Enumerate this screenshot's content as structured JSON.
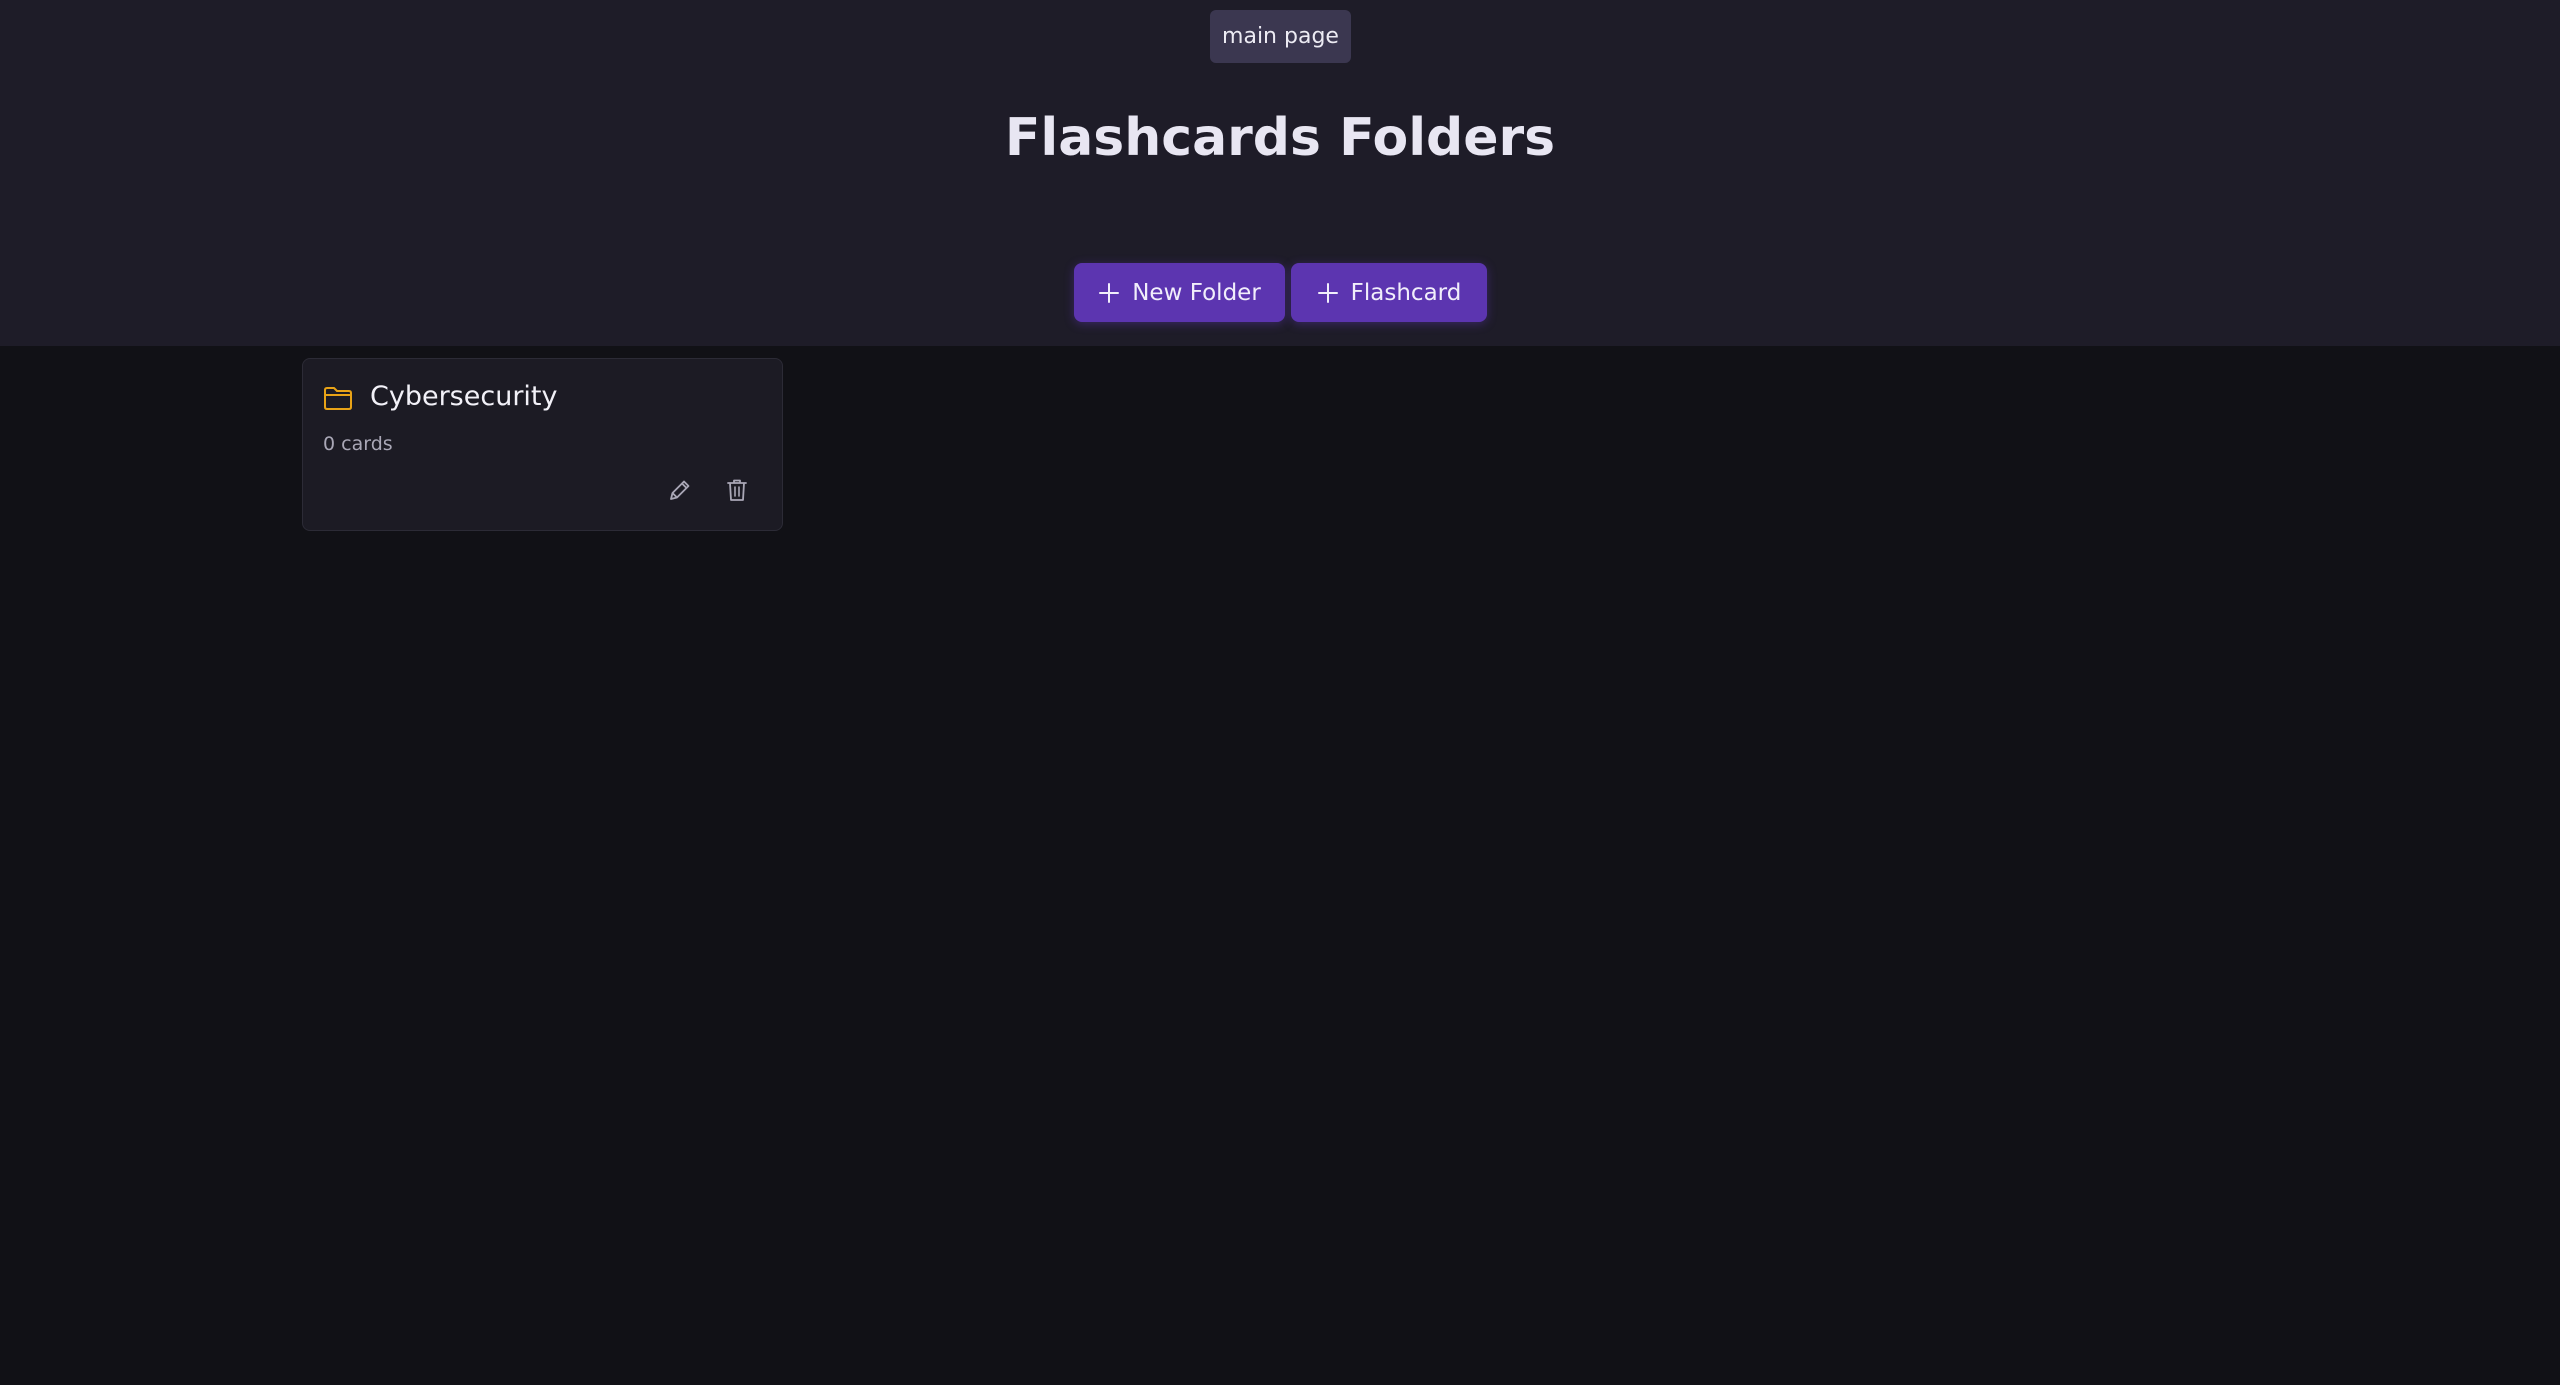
{
  "nav": {
    "main_page_label": "main page"
  },
  "header": {
    "title": "Flashcards Folders"
  },
  "actions": {
    "new_folder_label": "New Folder",
    "flashcard_label": "Flashcard",
    "icon": "plus-icon"
  },
  "folders": [
    {
      "name": "Cybersecurity",
      "count_text": "0 cards",
      "icon": "folder-icon",
      "edit_icon": "pencil-icon",
      "delete_icon": "trash-icon"
    }
  ],
  "colors": {
    "header_bg": "#1e1c28",
    "page_bg": "#111116",
    "accent": "#5c35b0",
    "folder_icon": "#e8a317"
  }
}
